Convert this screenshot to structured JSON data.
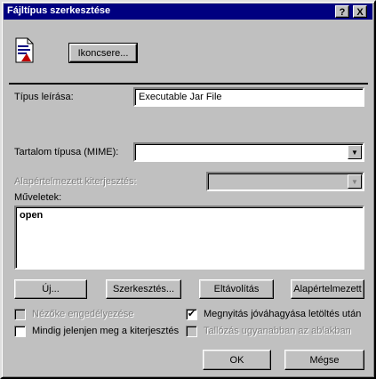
{
  "window": {
    "title": "Fájltípus szerkesztése",
    "help_btn": "?",
    "close_btn": "X"
  },
  "icon_change_button": "Ikoncsere...",
  "type_description": {
    "label": "Típus leírása:",
    "value": "Executable Jar File"
  },
  "mime_type": {
    "label": "Tartalom típusa (MIME):",
    "value": ""
  },
  "default_extension": {
    "label": "Alapértelmezett kiterjesztés:",
    "value": ""
  },
  "actions": {
    "label": "Műveletek:",
    "items": [
      "open"
    ]
  },
  "action_buttons": {
    "new": "Új...",
    "edit": "Szerkesztés...",
    "remove": "Eltávolítás",
    "set_default": "Alapértelmezett"
  },
  "checkboxes": {
    "enable_viewer": {
      "label": "Nézőke engedélyezése",
      "checked": false,
      "enabled": false
    },
    "confirm_open": {
      "label": "Megnyitás jóváhagyása letöltés után",
      "checked": true,
      "enabled": true
    },
    "always_show_ext": {
      "label": "Mindig jelenjen meg a kiterjesztés",
      "checked": false,
      "enabled": true
    },
    "browse_same_window": {
      "label": "Tallózás ugyanabban az ablakban",
      "checked": false,
      "enabled": false
    }
  },
  "footer": {
    "ok": "OK",
    "cancel": "Mégse"
  }
}
